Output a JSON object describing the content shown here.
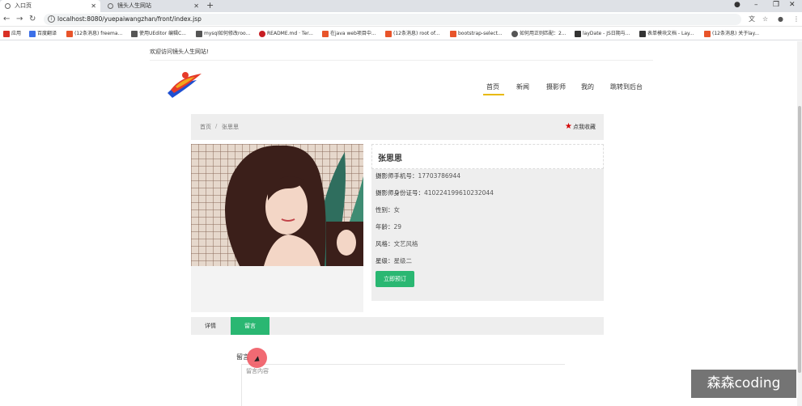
{
  "browser": {
    "tabs": [
      {
        "title": "入口页",
        "active": true
      },
      {
        "title": "镜头人生网站",
        "active": false
      }
    ],
    "new_tab": "+",
    "win_min": "–",
    "win_max": "❐",
    "win_close": "✕",
    "url": "localhost:8080/yuepaiwangzhan/front/index.jsp",
    "bookmarks": [
      {
        "label": "应用",
        "color": "#d93025"
      },
      {
        "label": "百度翻译",
        "color": "#3b6fe8"
      },
      {
        "label": "(12条消息) freema...",
        "color": "#e8542a"
      },
      {
        "label": "使用UEditor 编辑C...",
        "color": "#555555"
      },
      {
        "label": "mysql如何修改roo...",
        "color": "#555555"
      },
      {
        "label": "README.md · Ter...",
        "color": "#c71d23"
      },
      {
        "label": "在java web项目中...",
        "color": "#e8542a"
      },
      {
        "label": "(12条消息) root of...",
        "color": "#e8542a"
      },
      {
        "label": "bootstrap-select...",
        "color": "#e8542a"
      },
      {
        "label": "如何用正则匹配：2...",
        "color": "#555555"
      },
      {
        "label": "layDate - JS日期与...",
        "color": "#333333"
      },
      {
        "label": "表单模块文档 - Lay...",
        "color": "#333333"
      },
      {
        "label": "(12条消息) 关于lay...",
        "color": "#e8542a"
      }
    ]
  },
  "site": {
    "welcome": "欢迎访问镜头人生网站!",
    "nav": [
      "首页",
      "新闻",
      "摄影师",
      "我的",
      "跳转到后台"
    ],
    "accent": "#e8b900",
    "green": "#2ab772"
  },
  "breadcrumb": {
    "home": "首页",
    "sep": "/",
    "current": "张思思",
    "favorite": "点我收藏"
  },
  "profile": {
    "name": "张思思",
    "fields": [
      {
        "label": "摄影师手机号：",
        "value": "17703786944"
      },
      {
        "label": "摄影师身份证号：",
        "value": "410224199610232044"
      },
      {
        "label": "性别：",
        "value": "女"
      },
      {
        "label": "年龄：",
        "value": "29"
      },
      {
        "label": "风格：",
        "value": "文艺风格"
      },
      {
        "label": "星级：",
        "value": "星级二"
      }
    ],
    "book_button": "立即预订"
  },
  "detail_tabs": [
    "详情",
    "留言"
  ],
  "comment": {
    "label": "留言",
    "placeholder": "留言内容"
  },
  "watermark": "森森coding"
}
